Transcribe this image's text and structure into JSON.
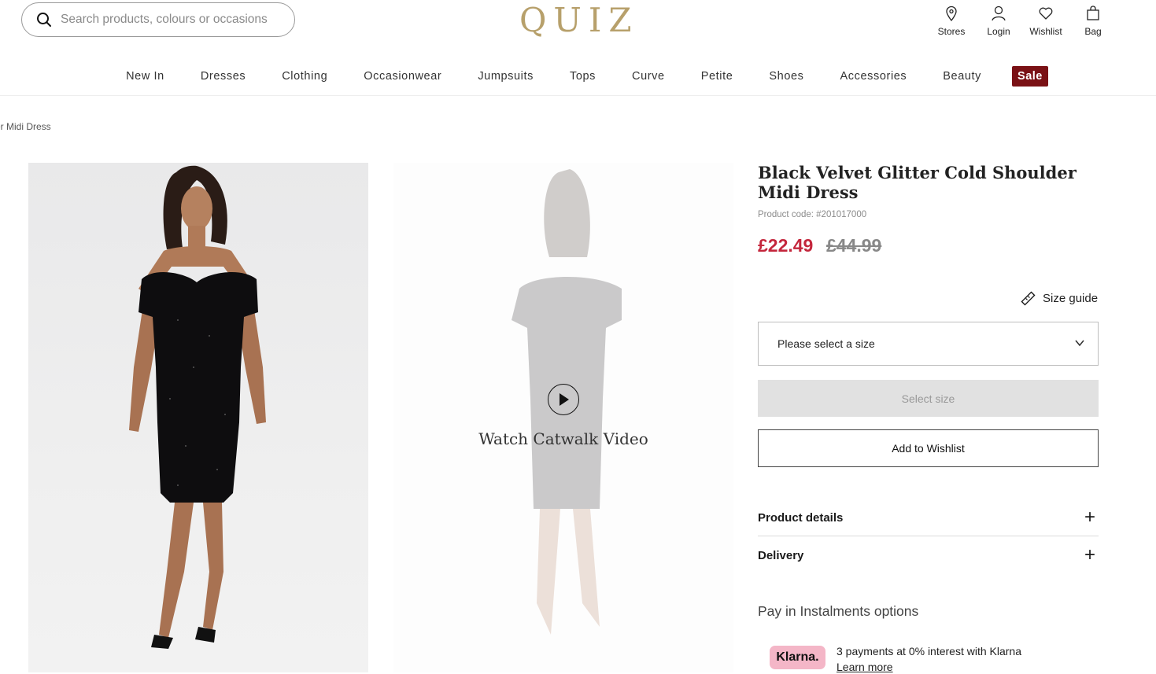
{
  "header": {
    "search_placeholder": "Search products, colours or occasions",
    "logo": "QUIZ",
    "utils": [
      {
        "label": "Stores",
        "icon": "map-pin-icon"
      },
      {
        "label": "Login",
        "icon": "user-icon"
      },
      {
        "label": "Wishlist",
        "icon": "heart-icon"
      },
      {
        "label": "Bag",
        "icon": "bag-icon"
      }
    ]
  },
  "nav": [
    "New In",
    "Dresses",
    "Clothing",
    "Occasionwear",
    "Jumpsuits",
    "Tops",
    "Curve",
    "Petite",
    "Shoes",
    "Accessories",
    "Beauty"
  ],
  "nav_sale": "Sale",
  "breadcrumb": "er Midi Dress",
  "gallery": {
    "video_label": "Watch Catwalk Video"
  },
  "product": {
    "title": "Black Velvet Glitter Cold Shoulder Midi Dress",
    "code": "Product code: #201017000",
    "price": "£22.49",
    "old_price": "£44.99",
    "size_guide": "Size guide",
    "size_select": "Please select a size",
    "select_size_button": "Select size",
    "wishlist_button": "Add to Wishlist",
    "accordions": [
      "Product details",
      "Delivery"
    ],
    "pay_title": "Pay in Instalments options",
    "klarna_logo": "Klarna.",
    "klarna_text": "3 payments at 0% interest with Klarna",
    "klarna_link": "Learn more"
  },
  "colors": {
    "brand_gold": "#b7a06b",
    "sale_bg": "#7a1115",
    "price_red": "#c4263c",
    "klarna_pink": "#f4b6c7"
  }
}
